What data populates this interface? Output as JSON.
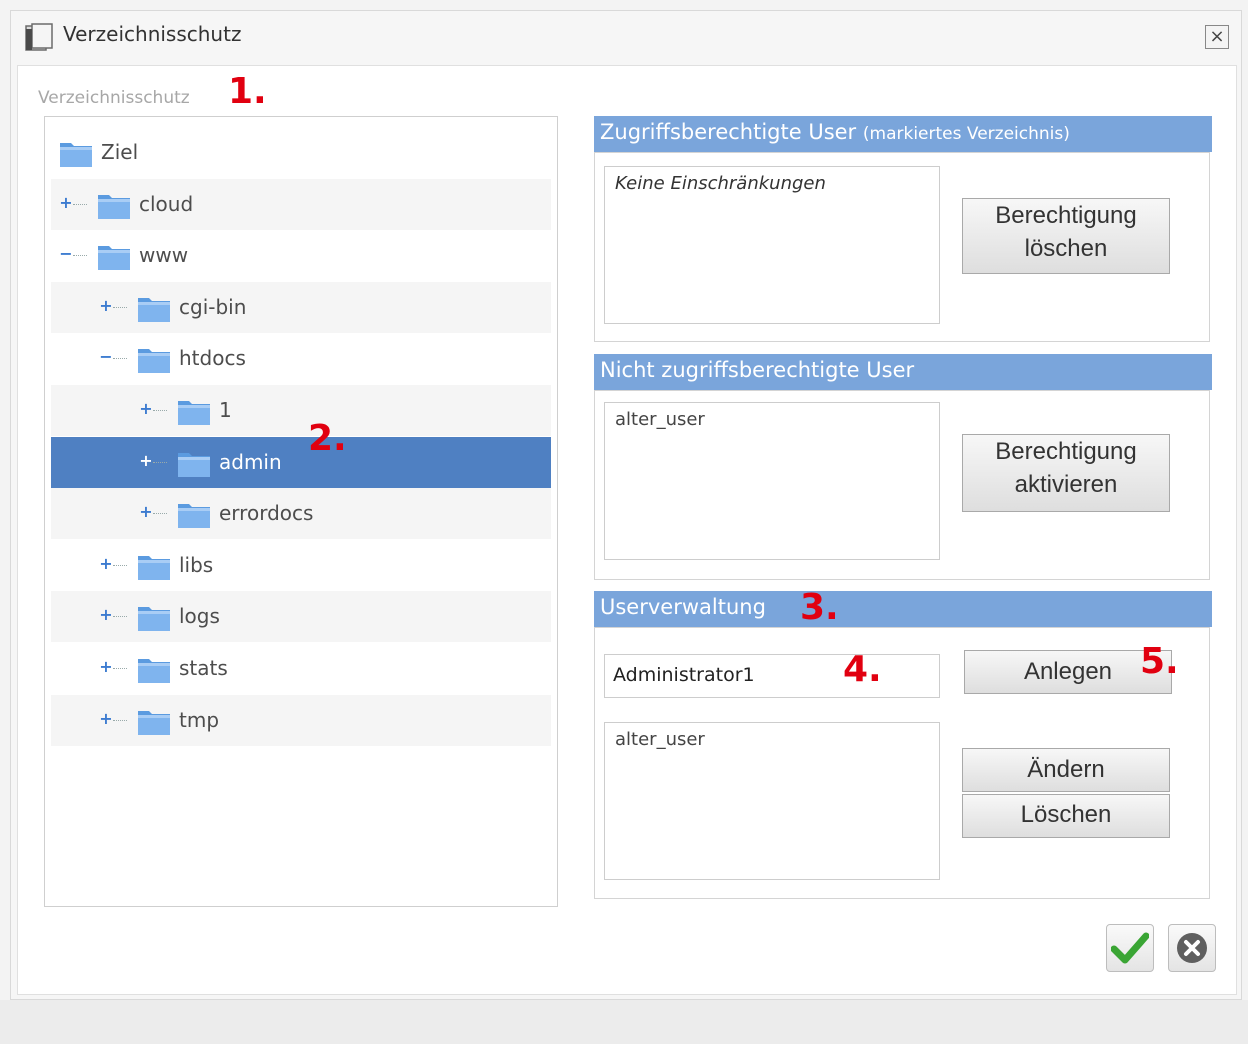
{
  "window": {
    "title": "Verzeichnisschutz",
    "close_glyph": "×"
  },
  "section_label": "Verzeichnisschutz",
  "markers": [
    "1.",
    "2.",
    "3.",
    "4.",
    "5."
  ],
  "tree": {
    "root": "Ziel",
    "items": [
      {
        "label": "cloud",
        "toggle": "+"
      },
      {
        "label": "www",
        "toggle": "−"
      },
      {
        "label": "cgi-bin",
        "toggle": "+"
      },
      {
        "label": "htdocs",
        "toggle": "−"
      },
      {
        "label": "1",
        "toggle": "+"
      },
      {
        "label": "admin",
        "toggle": "+",
        "selected": true
      },
      {
        "label": "errordocs",
        "toggle": "+"
      },
      {
        "label": "libs",
        "toggle": "+"
      },
      {
        "label": "logs",
        "toggle": "+"
      },
      {
        "label": "stats",
        "toggle": "+"
      },
      {
        "label": "tmp",
        "toggle": "+"
      }
    ]
  },
  "allowed": {
    "title": "Zugriffsberechtigte User",
    "subtitle": "(markiertes Verzeichnis)",
    "list": "Keine Einschränkungen",
    "button_line1": "Berechtigung",
    "button_line2": "löschen"
  },
  "denied": {
    "title": "Nicht zugriffsberechtigte User",
    "list": "alter_user",
    "button_line1": "Berechtigung",
    "button_line2": "aktivieren"
  },
  "users": {
    "title": "Userverwaltung",
    "input_value": "Administrator1",
    "create_label": "Anlegen",
    "list": "alter_user",
    "change_label": "Ändern",
    "delete_label": "Löschen"
  },
  "colors": {
    "header": "#7aa5db",
    "selected": "#4f80c2",
    "marker": "#e10010",
    "ok": "#3aa534"
  }
}
